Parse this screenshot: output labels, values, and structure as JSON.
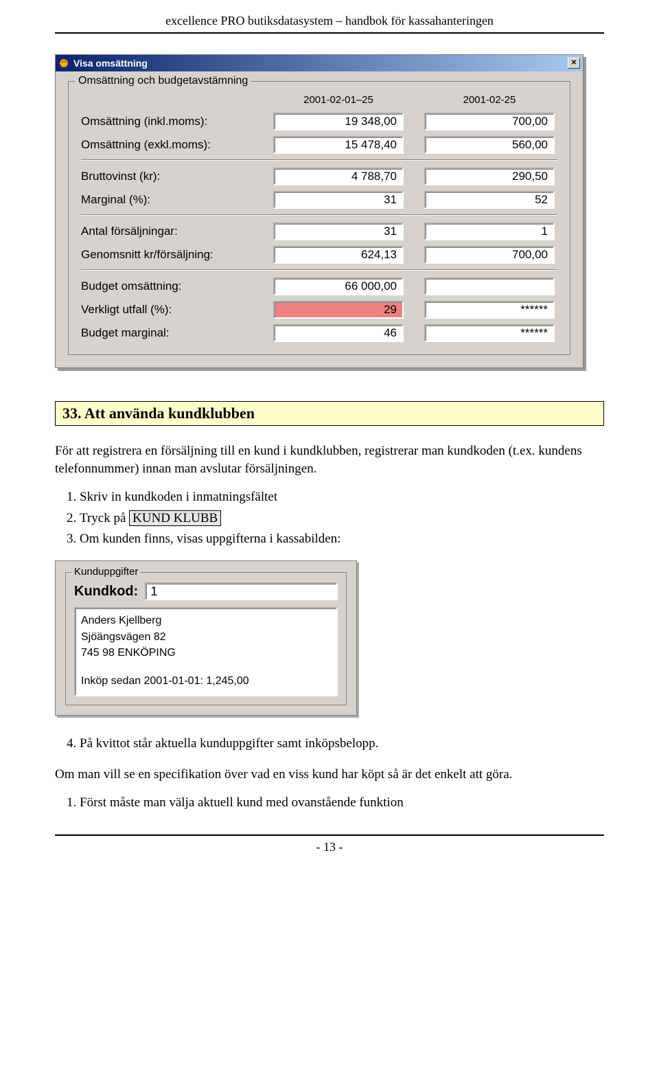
{
  "doc": {
    "header": "excellence PRO butiksdatasystem – handbok för kassahanteringen",
    "footer": "- 13 -"
  },
  "window": {
    "title": "Visa omsättning",
    "group_legend": "Omsättning och budgetavstämning",
    "columns": {
      "a": "2001-02-01–25",
      "b": "2001-02-25"
    },
    "rows": {
      "oms_inkl": {
        "label": "Omsättning (inkl.moms):",
        "a": "19 348,00",
        "b": "700,00"
      },
      "oms_exkl": {
        "label": "Omsättning (exkl.moms):",
        "a": "15 478,40",
        "b": "560,00"
      },
      "brutto": {
        "label": "Bruttovinst (kr):",
        "a": "4 788,70",
        "b": "290,50"
      },
      "marginal": {
        "label": "Marginal (%):",
        "a": "31",
        "b": "52"
      },
      "antal": {
        "label": "Antal försäljningar:",
        "a": "31",
        "b": "1"
      },
      "genomsnitt": {
        "label": "Genomsnitt kr/försäljning:",
        "a": "624,13",
        "b": "700,00"
      },
      "budget_oms": {
        "label": "Budget omsättning:",
        "a": "66 000,00",
        "b": ""
      },
      "utfall": {
        "label": "Verkligt utfall (%):",
        "a": "29",
        "b": "******"
      },
      "budget_marg": {
        "label": "Budget marginal:",
        "a": "46",
        "b": "******"
      }
    }
  },
  "section": {
    "heading": "33. Att använda kundklubben",
    "intro": "För att registrera en försäljning till en kund i kundklubben, registrerar man kundkoden (t.ex. kundens telefonnummer) innan man avslutar försäljningen.",
    "step1": "Skriv in kundkoden i inmatningsfältet",
    "step2_pre": "Tryck på ",
    "step2_kbd": "KUND KLUBB",
    "step3": "Om kunden finns, visas uppgifterna i kassabilden:",
    "step4": "På kvittot står aktuella kunduppgifter samt inköpsbelopp.",
    "post": "Om man vill se en specifikation över vad en viss kund har köpt så är det enkelt att göra.",
    "step5": "Först måste man välja aktuell kund med ovanstående funktion"
  },
  "panel": {
    "legend": "Kunduppgifter",
    "kundkod_label": "Kundkod:",
    "kundkod_value": "1",
    "info_line1": "Anders Kjellberg",
    "info_line2": "Sjöängsvägen 82",
    "info_line3": "745 98  ENKÖPING",
    "info_purchase": "Inköp sedan 2001-01-01: 1,245,00"
  }
}
